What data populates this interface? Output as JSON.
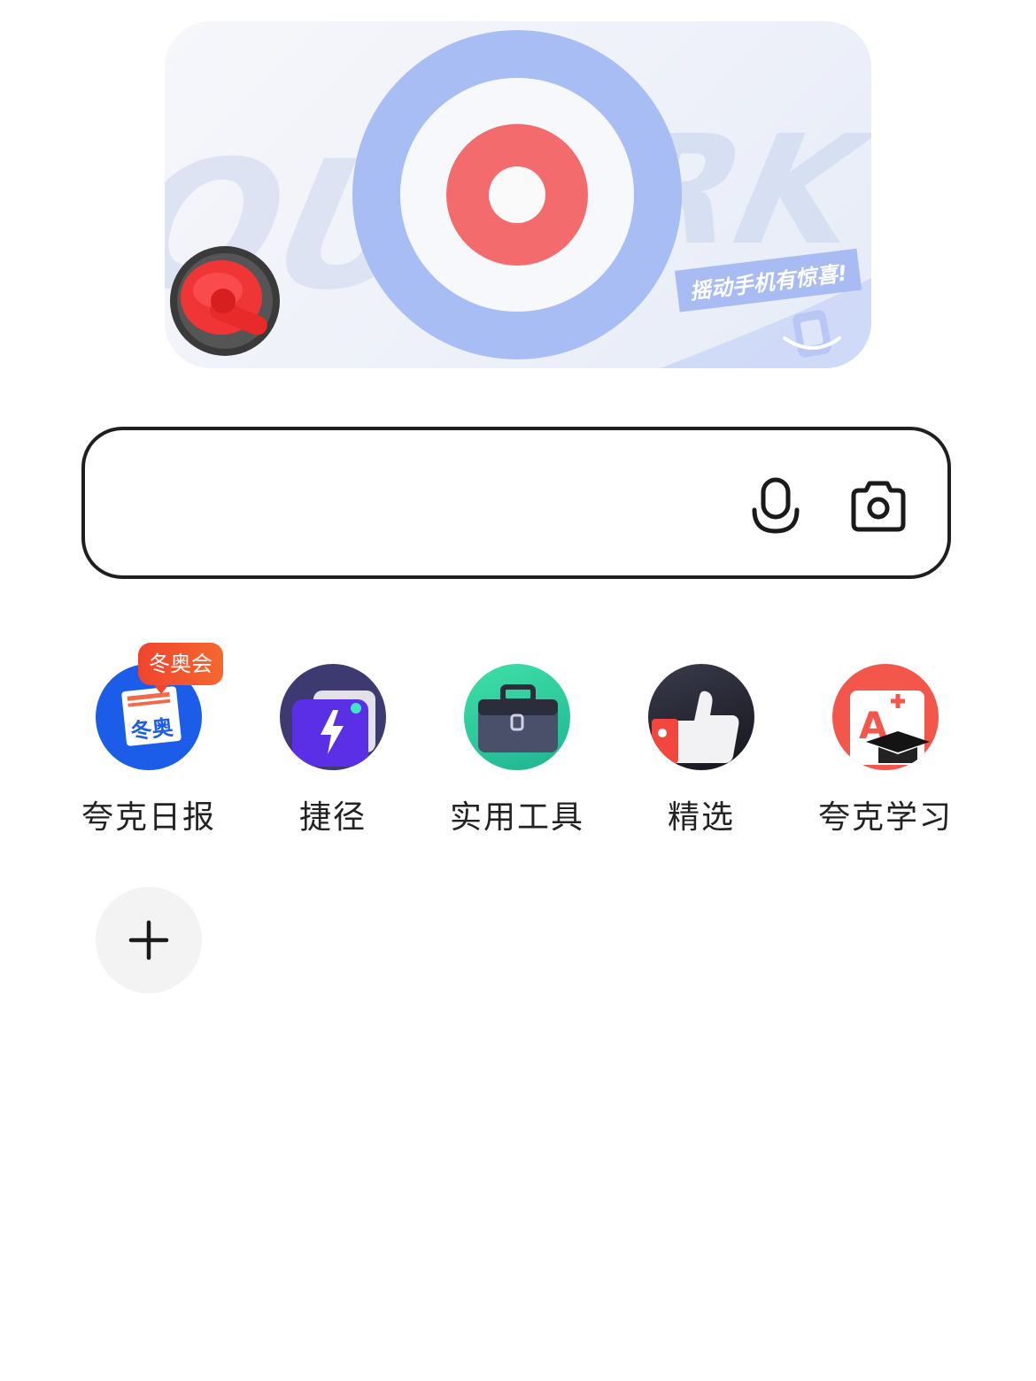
{
  "banner": {
    "bg_letters_left": "QU",
    "bg_letters_right": "RK",
    "shake_text": "摇动手机有惊喜!"
  },
  "search": {
    "value": "",
    "placeholder": "",
    "mic_icon": "microphone-icon",
    "camera_icon": "camera-icon"
  },
  "shortcuts": [
    {
      "label": "夸克日报",
      "icon": "daily-news-icon",
      "badge": "冬奥会",
      "badge_color": "#f0442e",
      "icon_text": "冬奥"
    },
    {
      "label": "捷径",
      "icon": "lightning-icon",
      "color": "#3d3a72"
    },
    {
      "label": "实用工具",
      "icon": "toolbox-icon",
      "color": "#2fd4a0"
    },
    {
      "label": "精选",
      "icon": "thumbs-up-icon",
      "color": "#2a2a36"
    },
    {
      "label": "夸克学习",
      "icon": "study-icon",
      "color": "#f3564a",
      "icon_text": "A"
    }
  ],
  "add_button": {
    "icon": "plus-icon"
  },
  "colors": {
    "target_blue": "#a9bdf5",
    "target_red": "#f46b6e",
    "border": "#1f1f1f"
  }
}
